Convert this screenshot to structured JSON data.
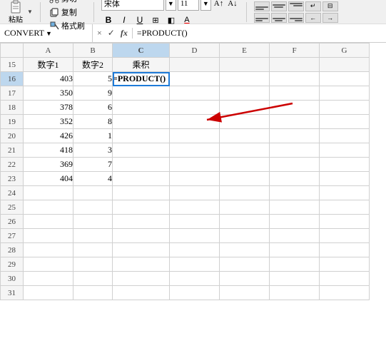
{
  "toolbar": {
    "paste_label": "粘贴",
    "cut_label": "剪切",
    "copy_label": "复制",
    "format_label": "格式刷",
    "font_name": "宋体",
    "font_size": "11",
    "bold_label": "B",
    "italic_label": "I",
    "underline_label": "U",
    "border_label": "⊞",
    "fill_label": "A",
    "font_color_label": "A"
  },
  "formula_bar": {
    "name_box_value": "CONVERT",
    "cancel_label": "×",
    "confirm_label": "✓",
    "fx_label": "fx",
    "formula_value": "=PRODUCT()"
  },
  "columns": {
    "headers": [
      "",
      "A",
      "B",
      "C",
      "D",
      "E",
      "F",
      "G"
    ]
  },
  "rows": [
    {
      "row_num": "15",
      "a": "数字1",
      "b": "数字2",
      "c": "乘积",
      "d": "",
      "e": "",
      "f": "",
      "g": ""
    },
    {
      "row_num": "16",
      "a": "403",
      "b": "5",
      "c": "=PRODUCT()",
      "d": "",
      "e": "",
      "f": "",
      "g": "",
      "active": true
    },
    {
      "row_num": "17",
      "a": "350",
      "b": "9",
      "c": "",
      "d": "",
      "e": "",
      "f": "",
      "g": ""
    },
    {
      "row_num": "18",
      "a": "378",
      "b": "6",
      "c": "",
      "d": "",
      "e": "",
      "f": "",
      "g": ""
    },
    {
      "row_num": "19",
      "a": "352",
      "b": "8",
      "c": "",
      "d": "",
      "e": "",
      "f": "",
      "g": ""
    },
    {
      "row_num": "20",
      "a": "426",
      "b": "1",
      "c": "",
      "d": "",
      "e": "",
      "f": "",
      "g": ""
    },
    {
      "row_num": "21",
      "a": "418",
      "b": "3",
      "c": "",
      "d": "",
      "e": "",
      "f": "",
      "g": ""
    },
    {
      "row_num": "22",
      "a": "369",
      "b": "7",
      "c": "",
      "d": "",
      "e": "",
      "f": "",
      "g": ""
    },
    {
      "row_num": "23",
      "a": "404",
      "b": "4",
      "c": "",
      "d": "",
      "e": "",
      "f": "",
      "g": ""
    },
    {
      "row_num": "24",
      "a": "",
      "b": "",
      "c": "",
      "d": "",
      "e": "",
      "f": "",
      "g": ""
    },
    {
      "row_num": "25",
      "a": "",
      "b": "",
      "c": "",
      "d": "",
      "e": "",
      "f": "",
      "g": ""
    },
    {
      "row_num": "26",
      "a": "",
      "b": "",
      "c": "",
      "d": "",
      "e": "",
      "f": "",
      "g": ""
    },
    {
      "row_num": "27",
      "a": "",
      "b": "",
      "c": "",
      "d": "",
      "e": "",
      "f": "",
      "g": ""
    },
    {
      "row_num": "28",
      "a": "",
      "b": "",
      "c": "",
      "d": "",
      "e": "",
      "f": "",
      "g": ""
    },
    {
      "row_num": "29",
      "a": "",
      "b": "",
      "c": "",
      "d": "",
      "e": "",
      "f": "",
      "g": ""
    },
    {
      "row_num": "30",
      "a": "",
      "b": "",
      "c": "",
      "d": "",
      "e": "",
      "f": "",
      "g": ""
    },
    {
      "row_num": "31",
      "a": "",
      "b": "",
      "c": "",
      "d": "",
      "e": "",
      "f": "",
      "g": ""
    }
  ],
  "arrow": {
    "label": "arrow pointing to formula cell"
  }
}
